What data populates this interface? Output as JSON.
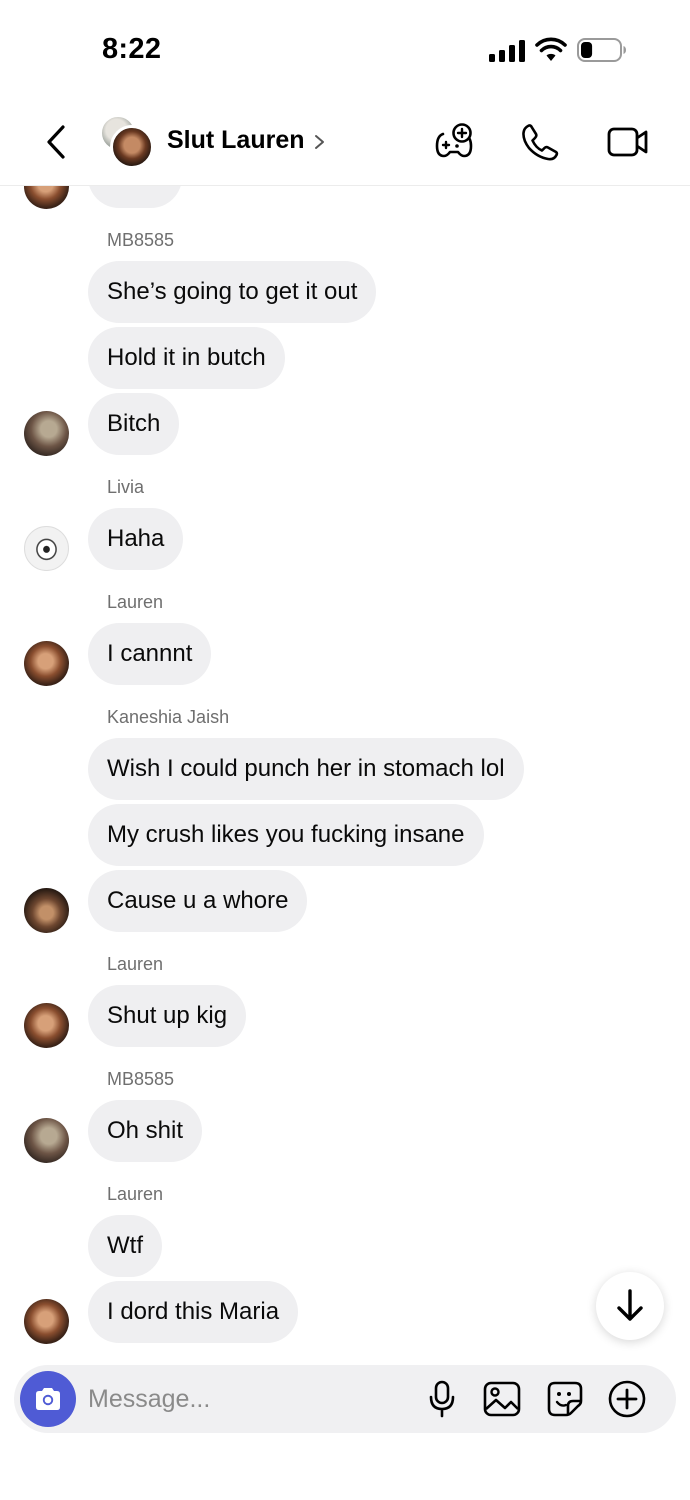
{
  "status_bar": {
    "time": "8:22",
    "battery_percent": 30
  },
  "header": {
    "title": "Slut Lauren",
    "icons": [
      "back-icon",
      "games-icon",
      "phone-icon",
      "video-icon"
    ]
  },
  "messages": [
    {
      "sender": "",
      "text": "",
      "avatar": "lauren"
    },
    {
      "sender": "MB8585",
      "text": "She’s going to get it out"
    },
    {
      "sender": "",
      "text": "Hold it in butch"
    },
    {
      "sender": "",
      "text": "Bitch",
      "avatar": "mb"
    },
    {
      "sender": "Livia",
      "text": "Haha",
      "avatar": "livia"
    },
    {
      "sender": "Lauren",
      "text": "I cannnt",
      "avatar": "lauren"
    },
    {
      "sender": "Kaneshia Jaish",
      "text": "Wish I could punch her in stomach lol"
    },
    {
      "sender": "",
      "text": "My crush likes you fucking insane"
    },
    {
      "sender": "",
      "text": "Cause u a whore",
      "avatar": "kaneshia"
    },
    {
      "sender": "Lauren",
      "text": "Shut up kig",
      "avatar": "lauren"
    },
    {
      "sender": "MB8585",
      "text": "Oh shit",
      "avatar": "mb"
    },
    {
      "sender": "Lauren",
      "text": "Wtf"
    },
    {
      "sender": "",
      "text": "I dord this Maria",
      "avatar": "lauren"
    }
  ],
  "composer": {
    "placeholder": "Message...",
    "icons": [
      "camera-icon",
      "microphone-icon",
      "gallery-icon",
      "sticker-icon",
      "add-icon"
    ]
  },
  "colors": {
    "bubble": "#efeff1",
    "camera_button": "#4f5bd5",
    "sender_label": "#6f6f6f"
  }
}
